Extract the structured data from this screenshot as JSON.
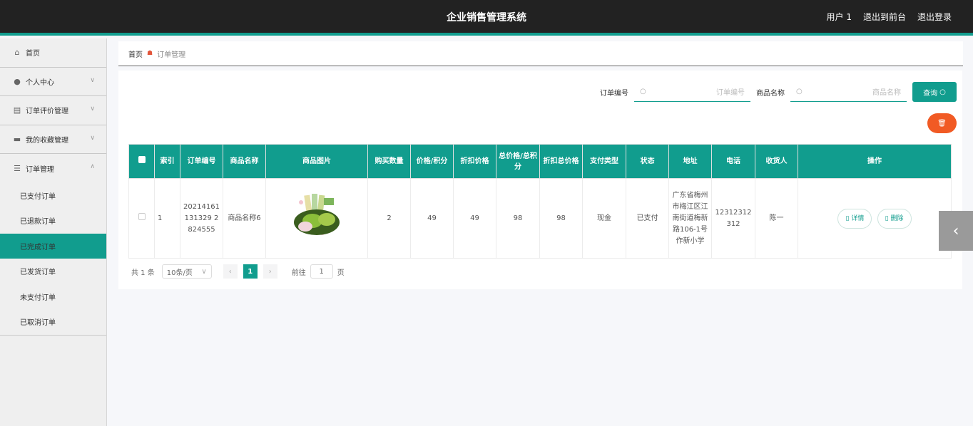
{
  "header": {
    "title": "企业销售管理系统",
    "links": [
      "用户 1",
      "退出到前台",
      "退出登录"
    ]
  },
  "sidebar": {
    "items": [
      {
        "label": "首页",
        "icon": "home-icon"
      },
      {
        "label": "个人中心",
        "icon": "user-icon"
      },
      {
        "label": "订单评价管理",
        "icon": "clipboard-icon"
      },
      {
        "label": "我的收藏管理",
        "icon": "ticket-icon"
      },
      {
        "label": "订单管理",
        "icon": "list-icon"
      }
    ],
    "subitems": [
      "已支付订单",
      "已退款订单",
      "已完成订单",
      "已发货订单",
      "未支付订单",
      "已取消订单"
    ],
    "active_sub": "已完成订单"
  },
  "breadcrumb": {
    "home": "首页",
    "current": "订单管理"
  },
  "search": {
    "order_label": "订单编号",
    "order_placeholder": "订单编号",
    "product_label": "商品名称",
    "product_placeholder": "商品名称",
    "query_label": "查询"
  },
  "table": {
    "headers": [
      "索引",
      "订单编号",
      "商品名称",
      "商品图片",
      "购买数量",
      "价格/积分",
      "折扣价格",
      "总价格/总积分",
      "折扣总价格",
      "支付类型",
      "状态",
      "地址",
      "电话",
      "收货人",
      "操作"
    ],
    "rows": [
      {
        "index": "1",
        "order_no": "20214161131329 2824555",
        "product_name": "商品名称6",
        "quantity": "2",
        "price": "49",
        "discount_price": "49",
        "total": "98",
        "discount_total": "98",
        "pay_type": "现金",
        "status": "已支付",
        "address": "广东省梅州市梅江区江南街道梅新路106-1号作新小学",
        "phone": "12312312312",
        "receiver": "陈一",
        "detail_label": "详情",
        "delete_label": "删除"
      }
    ]
  },
  "pager": {
    "total": "共 1 条",
    "page_size": "10条/页",
    "current_page": "1",
    "goto_label": "前往",
    "goto_value": "1",
    "page_unit": "页"
  },
  "colors": {
    "accent": "#119d8e",
    "danger": "#f15a24",
    "topbar": "#222222"
  }
}
